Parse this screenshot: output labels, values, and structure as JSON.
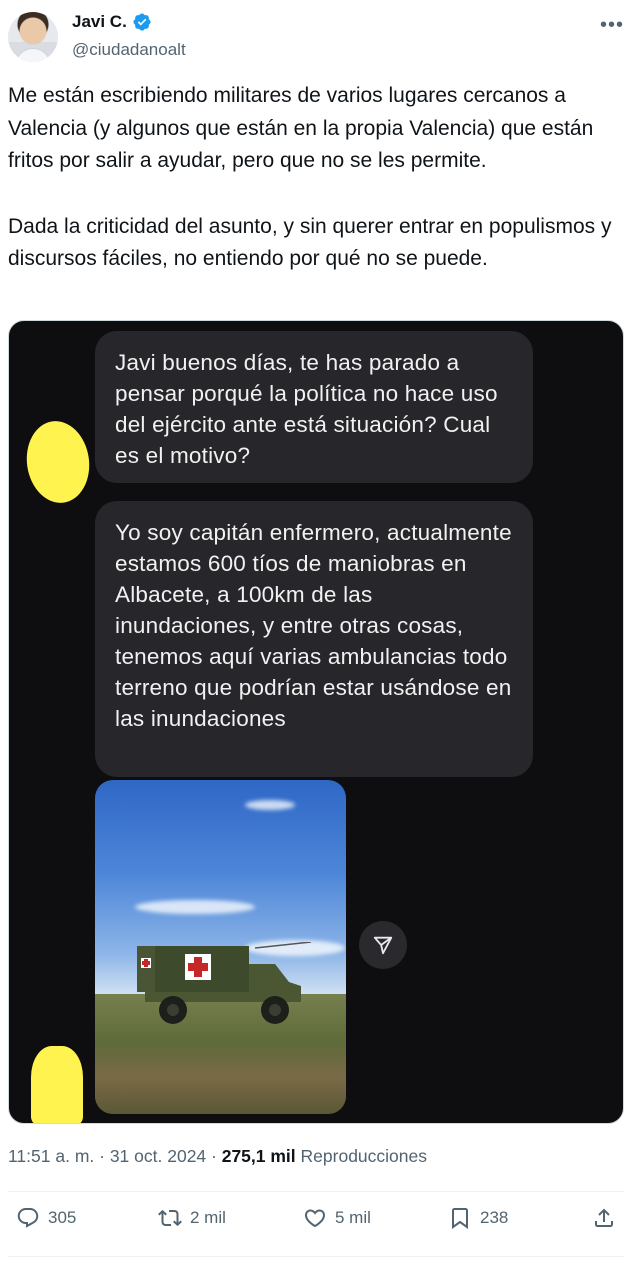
{
  "author": {
    "name": "Javi C.",
    "handle": "@ciudadanoalt",
    "verified": true
  },
  "tweet": {
    "paragraphs": [
      "Me están escribiendo militares de varios lugares cercanos a Valencia (y algunos que están en la propia Valencia) que están fritos por salir a ayudar, pero que no se les permite.",
      "Dada la criticidad del asunto, y sin querer entrar en populismos y discursos fáciles, no entiendo por qué no se puede."
    ]
  },
  "media": {
    "messages": [
      "Javi buenos días, te has parado a pensar porqué la política no hace uso del ejército ante está situación? Cual es el motivo?",
      "Yo soy capitán enfermero, actualmente estamos 600 tíos de maniobras en Albacete, a 100km de las inundaciones, y entre otras cosas, tenemos aquí varias ambulancias todo terreno que podrían estar usándose en las inundaciones"
    ],
    "redaction_color": "#fff44f",
    "photo_subject": "military-ambulance-photo"
  },
  "meta": {
    "time": "11:51 a. m.",
    "sep1": " · ",
    "date": "31 oct. 2024",
    "sep2": " · ",
    "views": "275,1 mil",
    "views_label": " Reproducciones"
  },
  "actions": {
    "replies": "305",
    "reposts": "2 mil",
    "likes": "5 mil",
    "bookmarks": "238"
  },
  "colors": {
    "text": "#0f1419",
    "secondary": "#536471",
    "verified": "#1d9bf0",
    "bubble": "#27272b"
  }
}
